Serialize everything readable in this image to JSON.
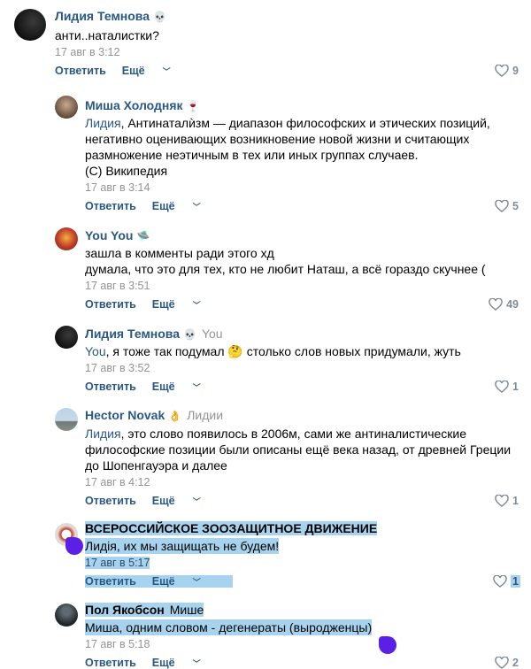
{
  "comments": [
    {
      "author": "Лидия Темнова",
      "author_emoji": "💀",
      "reply_to": "",
      "text": "анти..наталистки?",
      "date": "17 авг в 3:12",
      "reply_label": "Ответить",
      "more_label": "Ещё",
      "likes": "9"
    },
    {
      "author": "Миша Холодняк",
      "author_emoji": "🍷",
      "reply_to": "",
      "mention": "Лидия",
      "text": ", Антинаталѝзм — диапазон философских и этических позиций,\nнегативно оценивающих возникновение новой жизни и считающих\nразмножение неэтичным в тех или иных группах случаев.\n(С) Википедия",
      "date": "17 авг в 3:14",
      "reply_label": "Ответить",
      "more_label": "Ещё",
      "likes": "5"
    },
    {
      "author": "You You",
      "author_emoji": "🛸",
      "reply_to": "",
      "text": "зашла в комменты ради этого хд\nдумала, что это для тех, кто не любит Наташ, а всё гораздо скучнее (",
      "date": "17 авг в 3:51",
      "reply_label": "Ответить",
      "more_label": "Ещё",
      "likes": "49"
    },
    {
      "author": "Лидия Темнова",
      "author_emoji": "💀",
      "reply_to": "You",
      "mention": "You",
      "text": ", я тоже так подумал 🤔 столько слов новых придумали, жуть",
      "date": "17 авг в 3:52",
      "reply_label": "Ответить",
      "more_label": "Ещё",
      "likes": "1"
    },
    {
      "author": "Hector Novak",
      "author_emoji": "👌",
      "reply_to": "Лидии",
      "mention": "Лидия",
      "text": ", это слово появилось в 2006м, сами же антиналистические\nфилософские позиции были описаны ещё века назад, от древней Греции\nдо Шопенгауэра и далее",
      "date": "17 авг в 4:12",
      "reply_label": "Ответить",
      "more_label": "Ещё",
      "likes": "1"
    },
    {
      "author": "ВСЕРОССИЙСКОЕ ЗООЗАЩИТНОЕ ДВИЖЕНИЕ",
      "author_emoji": "",
      "reply_to": "",
      "text": "Лидія, их мы защищать не будем!",
      "date": "17 авг в 5:17",
      "reply_label": "Ответить",
      "more_label": "Ещё",
      "likes": "1"
    },
    {
      "author": "Пол Якобсон",
      "author_emoji": "",
      "reply_to": "Мише",
      "text": "Миша, одним словом - дегенераты (выродженцы)",
      "date": "17 авг в 5:18",
      "reply_label": "Ответить",
      "more_label": "Ещё",
      "likes": "2"
    }
  ],
  "colors": {
    "link": "#2a5885",
    "muted": "#939393",
    "highlight": "#a8d3ee",
    "marker": "#5b1fe5"
  }
}
